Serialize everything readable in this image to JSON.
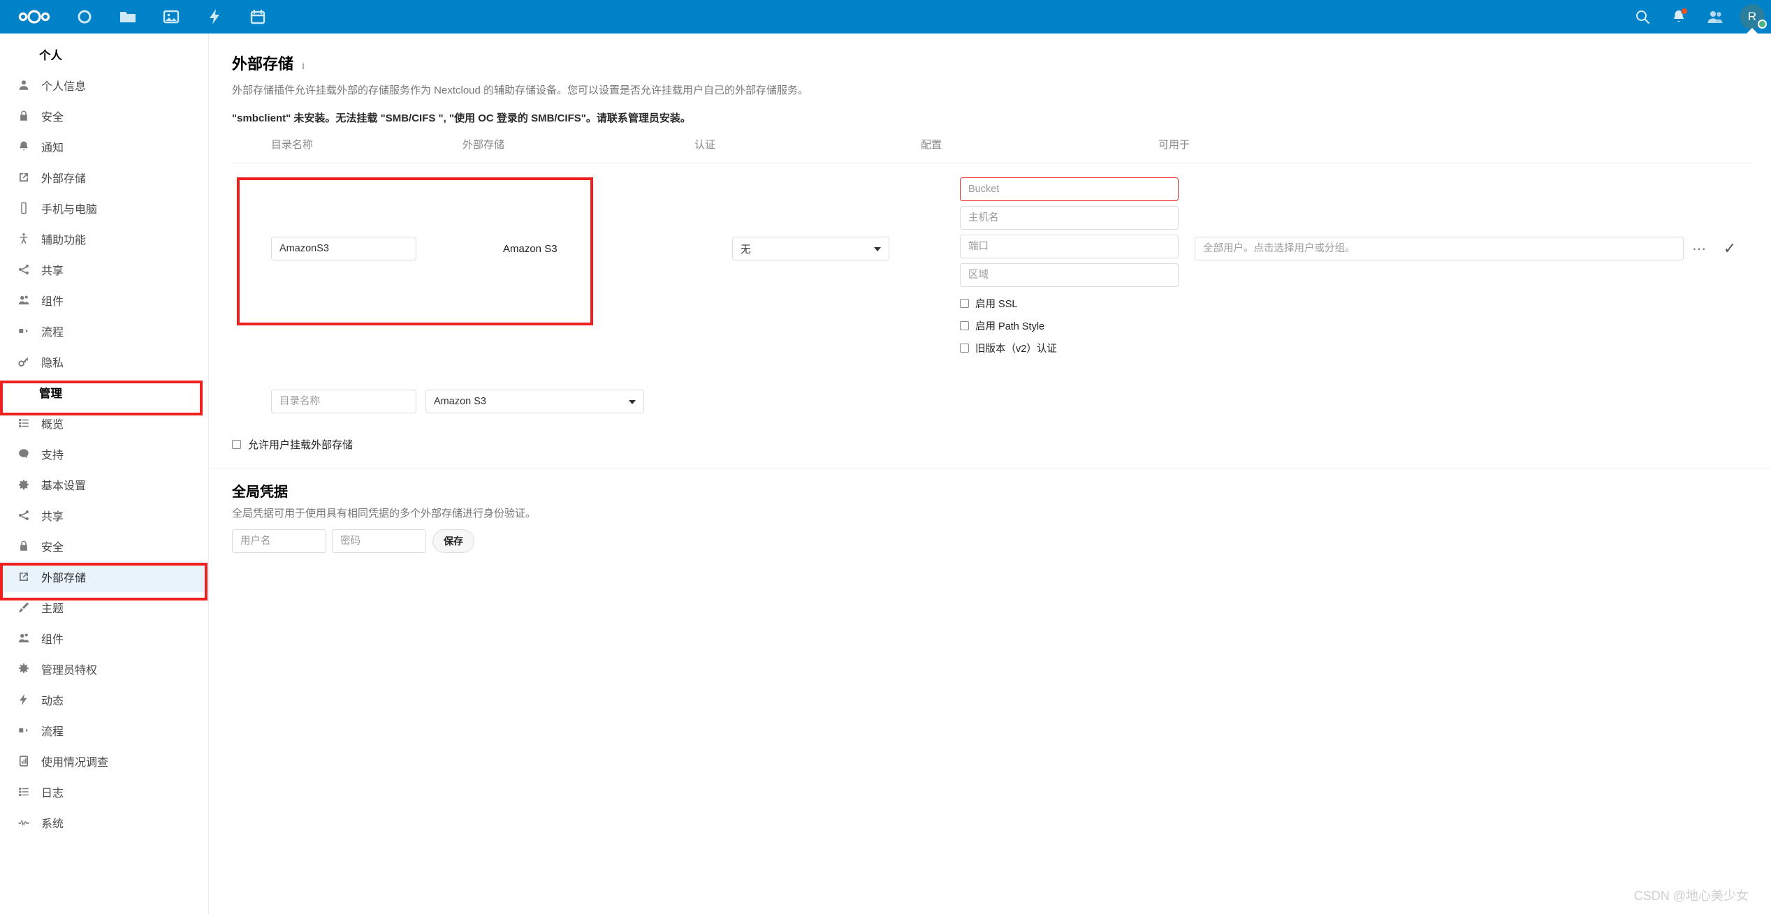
{
  "colors": {
    "brand": "#0082c9",
    "annotation": "#ef2020",
    "active_bg": "#e8f3fb",
    "error_border": "#e9322d",
    "status_online": "#49b382"
  },
  "header": {
    "logo_name": "nextcloud-logo",
    "apps": [
      {
        "name": "dashboard-icon",
        "title": "Dashboard"
      },
      {
        "name": "files-icon",
        "title": "Files"
      },
      {
        "name": "photos-icon",
        "title": "Photos"
      },
      {
        "name": "activity-icon",
        "title": "Activity"
      },
      {
        "name": "calendar-icon",
        "title": "Calendar"
      }
    ],
    "search_icon": "search-icon",
    "notifications_icon": "bell-icon",
    "contacts_icon": "contacts-icon",
    "avatar_initial": "R"
  },
  "sidebar": {
    "personal_section": "个人",
    "personal_items": [
      {
        "label": "个人信息",
        "icon": "user-icon"
      },
      {
        "label": "安全",
        "icon": "lock-icon"
      },
      {
        "label": "通知",
        "icon": "bell-icon"
      },
      {
        "label": "外部存储",
        "icon": "external-storage-icon"
      },
      {
        "label": "手机与电脑",
        "icon": "devices-icon"
      },
      {
        "label": "辅助功能",
        "icon": "accessibility-icon"
      },
      {
        "label": "共享",
        "icon": "share-icon"
      },
      {
        "label": "组件",
        "icon": "groupware-icon"
      },
      {
        "label": "流程",
        "icon": "workflow-icon"
      },
      {
        "label": "隐私",
        "icon": "privacy-key-icon"
      }
    ],
    "admin_section": "管理",
    "admin_items": [
      {
        "label": "概览",
        "icon": "overview-icon",
        "active": false
      },
      {
        "label": "支持",
        "icon": "support-icon",
        "active": false
      },
      {
        "label": "基本设置",
        "icon": "gear-icon",
        "active": false
      },
      {
        "label": "共享",
        "icon": "share-icon",
        "active": false
      },
      {
        "label": "安全",
        "icon": "lock-icon",
        "active": false
      },
      {
        "label": "外部存储",
        "icon": "external-storage-icon",
        "active": true
      },
      {
        "label": "主题",
        "icon": "theming-icon",
        "active": false
      },
      {
        "label": "组件",
        "icon": "groupware-icon",
        "active": false
      },
      {
        "label": "管理员特权",
        "icon": "admin-privileges-icon",
        "active": false
      },
      {
        "label": "动态",
        "icon": "activity-icon",
        "active": false
      },
      {
        "label": "流程",
        "icon": "workflow-icon",
        "active": false
      },
      {
        "label": "使用情况调查",
        "icon": "survey-icon",
        "active": false
      },
      {
        "label": "日志",
        "icon": "logging-icon",
        "active": false
      },
      {
        "label": "系统",
        "icon": "system-icon",
        "active": false
      }
    ]
  },
  "main": {
    "title": "外部存储",
    "info_icon": "info-icon",
    "description": "外部存储插件允许挂载外部的存储服务作为 Nextcloud 的辅助存储设备。您可以设置是否允许挂载用户自己的外部存储服务。",
    "warning": "\"smbclient\" 未安装。无法挂载 \"SMB/CIFS \", \"使用 OC 登录的 SMB/CIFS\"。请联系管理员安装。",
    "columns": {
      "folder_name": "目录名称",
      "external_storage": "外部存储",
      "authentication": "认证",
      "configuration": "配置",
      "available_for": "可用于"
    },
    "mount_row": {
      "folder_name_value": "AmazonS3",
      "folder_name_placeholder": "目录名称",
      "backend_label": "Amazon S3",
      "auth_value": "无",
      "config_fields": [
        {
          "name": "bucket-field",
          "placeholder": "Bucket",
          "value": "",
          "error": true
        },
        {
          "name": "hostname-field",
          "placeholder": "主机名",
          "value": "",
          "error": false
        },
        {
          "name": "port-field",
          "placeholder": "端口",
          "value": "",
          "error": false
        },
        {
          "name": "region-field",
          "placeholder": "区域",
          "value": "",
          "error": false
        }
      ],
      "config_checkboxes": [
        {
          "name": "enable-ssl-checkbox",
          "label": "启用 SSL",
          "checked": false
        },
        {
          "name": "enable-path-style-checkbox",
          "label": "启用 Path Style",
          "checked": false
        },
        {
          "name": "legacy-v2-auth-checkbox",
          "label": "旧版本（v2）认证",
          "checked": false
        }
      ],
      "available_for_placeholder": "全部用户。点击选择用户或分组。",
      "options_icon": "ellipsis-icon",
      "save_icon": "checkmark-icon"
    },
    "new_row": {
      "folder_name_placeholder": "目录名称",
      "backend_value": "Amazon S3"
    },
    "allow_user_mount_label": "允许用户挂载外部存储",
    "allow_user_mount_checked": false,
    "global_credentials": {
      "title": "全局凭据",
      "description": "全局凭据可用于使用具有相同凭据的多个外部存储进行身份验证。",
      "username_placeholder": "用户名",
      "password_placeholder": "密码",
      "save_label": "保存"
    }
  },
  "watermark": "CSDN @地心美少女"
}
